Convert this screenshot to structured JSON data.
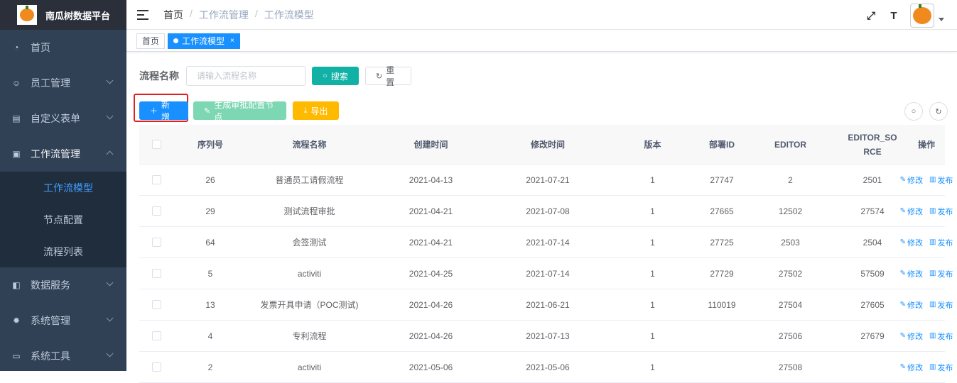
{
  "app": {
    "title": "南瓜树数据平台"
  },
  "sidebar": {
    "items": [
      {
        "label": "首页",
        "icon": "dashboard-icon"
      },
      {
        "label": "员工管理",
        "icon": "people-icon"
      },
      {
        "label": "自定义表单",
        "icon": "form-icon"
      },
      {
        "label": "工作流管理",
        "icon": "workflow-icon"
      },
      {
        "label": "数据服务",
        "icon": "data-icon"
      },
      {
        "label": "系统管理",
        "icon": "gear-icon"
      },
      {
        "label": "系统工具",
        "icon": "tool-icon"
      }
    ],
    "submenu": [
      {
        "label": "工作流模型"
      },
      {
        "label": "节点配置"
      },
      {
        "label": "流程列表"
      }
    ]
  },
  "navbar": {
    "breadcrumb": [
      "首页",
      "工作流管理",
      "工作流模型"
    ],
    "sep": "/",
    "size_icon_text": "T"
  },
  "tags": [
    {
      "label": "首页"
    },
    {
      "label": "工作流模型",
      "close": "×"
    }
  ],
  "search": {
    "label": "流程名称",
    "placeholder": "请输入流程名称",
    "search_label": "搜索",
    "reset_label": "重置"
  },
  "toolbar": {
    "add_label": "新增",
    "generate_label": "生成审批配置节点",
    "export_label": "导出"
  },
  "table": {
    "headers": [
      "序列号",
      "流程名称",
      "创建时间",
      "修改时间",
      "版本",
      "部署ID",
      "EDITOR",
      "EDITOR_SORCE",
      "操作"
    ],
    "edit_label": "修改",
    "publish_label": "发布",
    "rows": [
      [
        "26",
        "普通员工请假流程",
        "2021-04-13",
        "2021-07-21",
        "1",
        "27747",
        "2",
        "2501"
      ],
      [
        "29",
        "测试流程审批",
        "2021-04-21",
        "2021-07-08",
        "1",
        "27665",
        "12502",
        "27574"
      ],
      [
        "64",
        "会签测试",
        "2021-04-21",
        "2021-07-14",
        "1",
        "27725",
        "2503",
        "2504"
      ],
      [
        "5",
        "activiti",
        "2021-04-25",
        "2021-07-14",
        "1",
        "27729",
        "27502",
        "57509"
      ],
      [
        "13",
        "发票开具申请（POC测试)",
        "2021-04-26",
        "2021-06-21",
        "1",
        "110019",
        "27504",
        "27605"
      ],
      [
        "4",
        "专利流程",
        "2021-04-26",
        "2021-07-13",
        "1",
        "",
        "27506",
        "27679"
      ],
      [
        "2",
        "activiti",
        "2021-05-06",
        "2021-05-06",
        "1",
        "",
        "27508",
        ""
      ]
    ]
  },
  "colors": {
    "sidebar_bg": "#304156",
    "primary": "#1890ff",
    "teal": "#11b1a5",
    "warning": "#ffba00"
  }
}
